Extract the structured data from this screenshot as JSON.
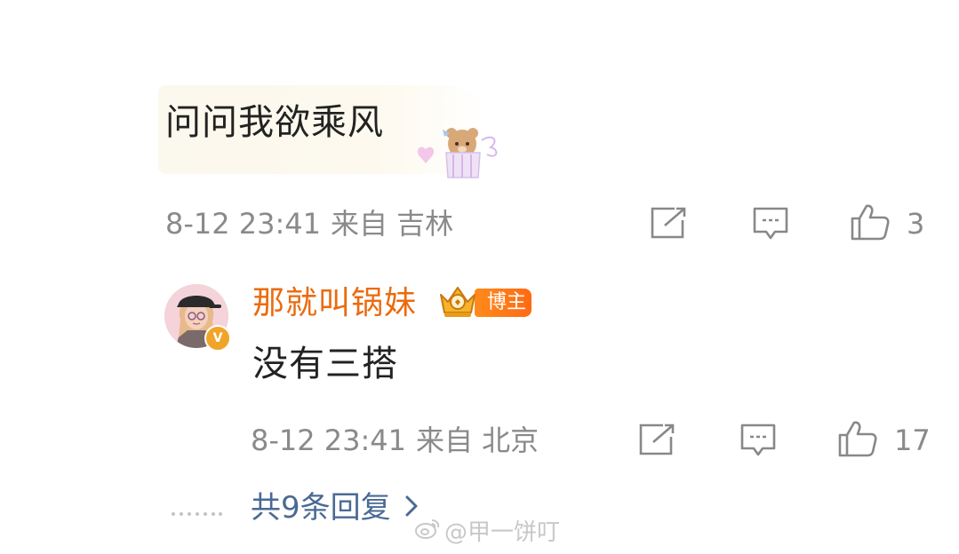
{
  "comment": {
    "text": "问问我欲乘风",
    "timestamp": "8-12 23:41",
    "location": "来自 吉林",
    "like_count": "3"
  },
  "reply": {
    "username": "那就叫锅妹",
    "badge": "博主",
    "text": "没有三搭",
    "timestamp": "8-12 23:41",
    "location": "来自 北京",
    "like_count": "17"
  },
  "more_replies": {
    "label": "共9条回复",
    "chevron": "chevron-right-icon"
  },
  "watermark": "@甲一饼叮",
  "colors": {
    "username": "#eb6b0f",
    "link": "#4a6a94",
    "meta": "#8a8a8a",
    "badge": "#ff7a18"
  }
}
